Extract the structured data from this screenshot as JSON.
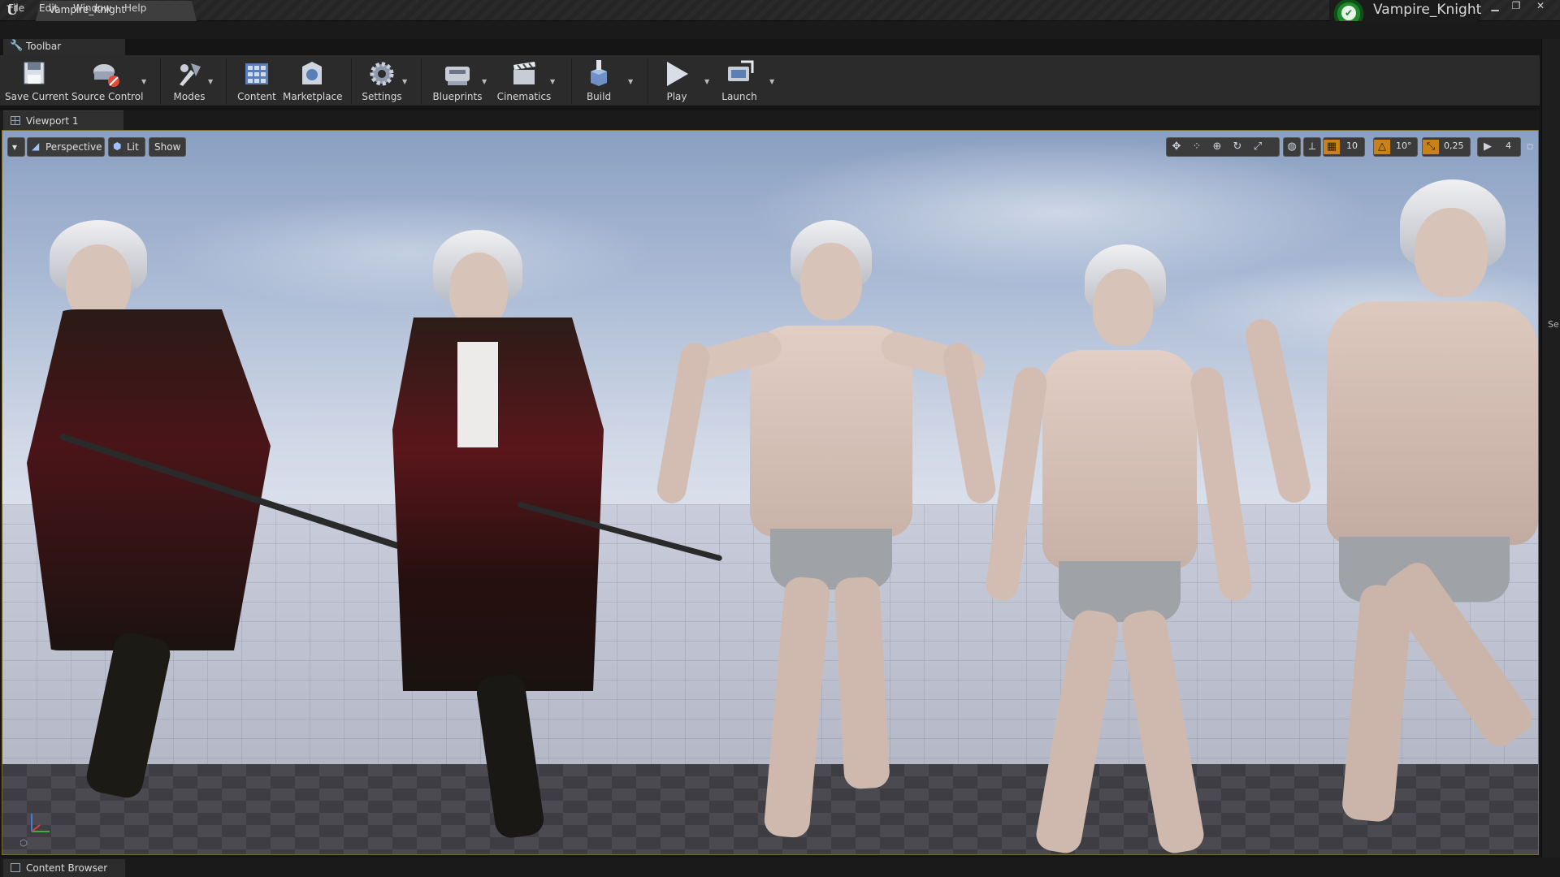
{
  "window": {
    "document_tab": "Vampire_Knight",
    "project_name": "Vampire_Knight",
    "controls": [
      "minimize",
      "restore",
      "close"
    ]
  },
  "menu": [
    "File",
    "Edit",
    "Window",
    "Help"
  ],
  "toolbar_panel": {
    "tab_label": "Toolbar",
    "buttons": [
      {
        "label": "Save Current",
        "icon": "save-icon"
      },
      {
        "label": "Source Control",
        "icon": "source-control-icon"
      },
      {
        "label": "Modes",
        "icon": "modes-icon"
      },
      {
        "label": "Content",
        "icon": "content-icon"
      },
      {
        "label": "Marketplace",
        "icon": "marketplace-icon"
      },
      {
        "label": "Settings",
        "icon": "settings-icon"
      },
      {
        "label": "Blueprints",
        "icon": "blueprints-icon"
      },
      {
        "label": "Cinematics",
        "icon": "cinematics-icon"
      },
      {
        "label": "Build",
        "icon": "build-icon"
      },
      {
        "label": "Play",
        "icon": "play-icon"
      },
      {
        "label": "Launch",
        "icon": "launch-icon"
      }
    ]
  },
  "viewport": {
    "tab_label": "Viewport 1",
    "view_mode": "Perspective",
    "lighting": "Lit",
    "show": "Show",
    "grid_snap": "10",
    "rotation_snap": "10°",
    "scale_snap": "0,25",
    "camera_speed": "4"
  },
  "bottom_panel": {
    "tab_label": "Content Browser"
  },
  "right_rail": {
    "label": "Se"
  },
  "colors": {
    "accent_orange": "#c9821a",
    "viewport_border": "#7a6a2c",
    "project_green": "#1d8a2b"
  }
}
